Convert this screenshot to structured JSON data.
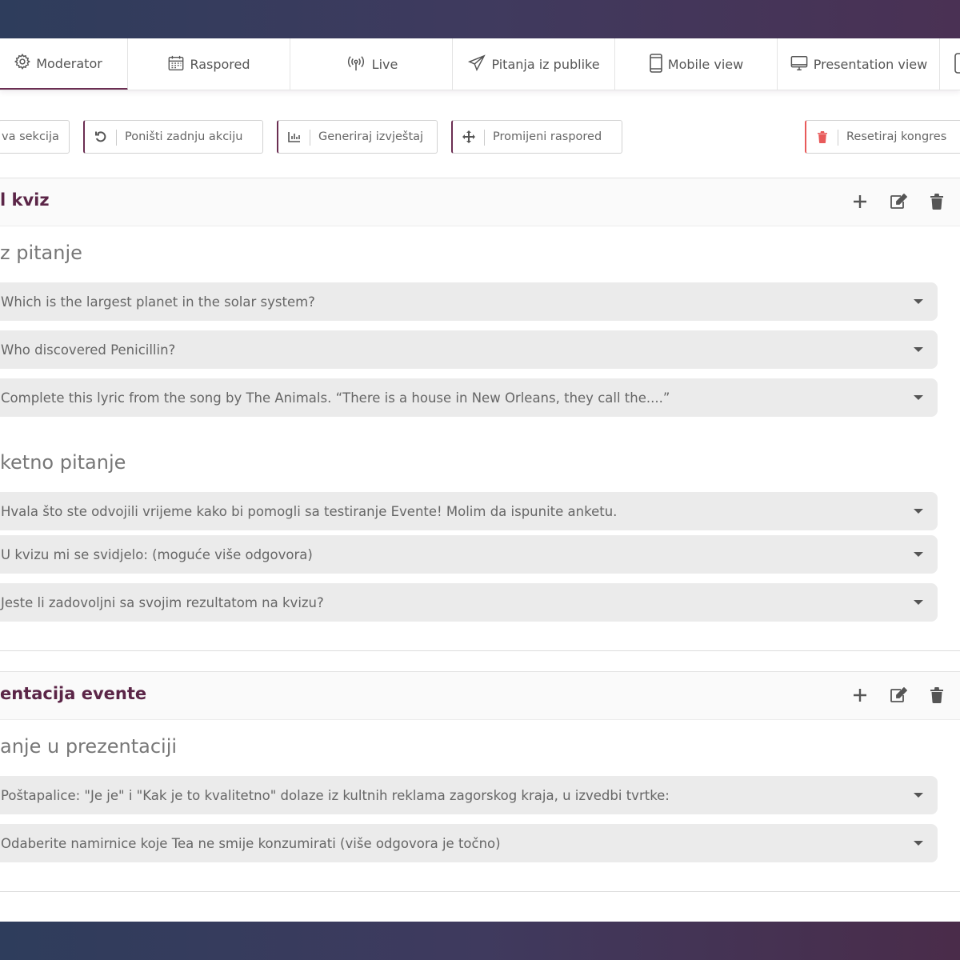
{
  "colors": {
    "accent": "#6b2e52",
    "danger": "#e85a5a",
    "row_bg": "#ebebeb"
  },
  "tabs": [
    {
      "label": "Moderator",
      "icon": "gear-icon",
      "active": true
    },
    {
      "label": "Raspored",
      "icon": "calendar-icon"
    },
    {
      "label": "Live",
      "icon": "broadcast-icon"
    },
    {
      "label": "Pitanja iz publike",
      "icon": "paper-plane-icon"
    },
    {
      "label": "Mobile view",
      "icon": "mobile-icon"
    },
    {
      "label": "Presentation view",
      "icon": "desktop-icon"
    }
  ],
  "toolbar": {
    "new_section": "va sekcija",
    "undo": "Poništi zadnju akciju",
    "report": "Generiraj izvještaj",
    "rearrange": "Promijeni raspored",
    "reset": "Resetiraj kongres"
  },
  "sections": [
    {
      "title": "l kviz",
      "groups": [
        {
          "title": "z pitanje",
          "questions": [
            "Which is the largest planet in the solar system?",
            "Who discovered Penicillin?",
            "Complete this lyric from the song by The Animals. “There is a house in New Orleans, they call the....”"
          ]
        },
        {
          "title": "ketno pitanje",
          "questions": [
            "Hvala što ste odvojili vrijeme kako bi pomogli sa testiranje Evente! Molim da ispunite anketu.",
            "U kvizu mi se svidjelo: (moguće više odgovora)",
            "Jeste li zadovoljni sa svojim rezultatom na kvizu?"
          ]
        }
      ]
    },
    {
      "title": "entacija evente",
      "groups": [
        {
          "title": "anje u prezentaciji",
          "questions": [
            "Poštapalice: \"Je je\" i \"Kak je to kvalitetno\" dolaze iz kultnih reklama zagorskog kraja, u izvedbi tvrtke:",
            "Odaberite namirnice koje Tea ne smije konzumirati (više odgovora je točno)"
          ]
        }
      ]
    }
  ]
}
